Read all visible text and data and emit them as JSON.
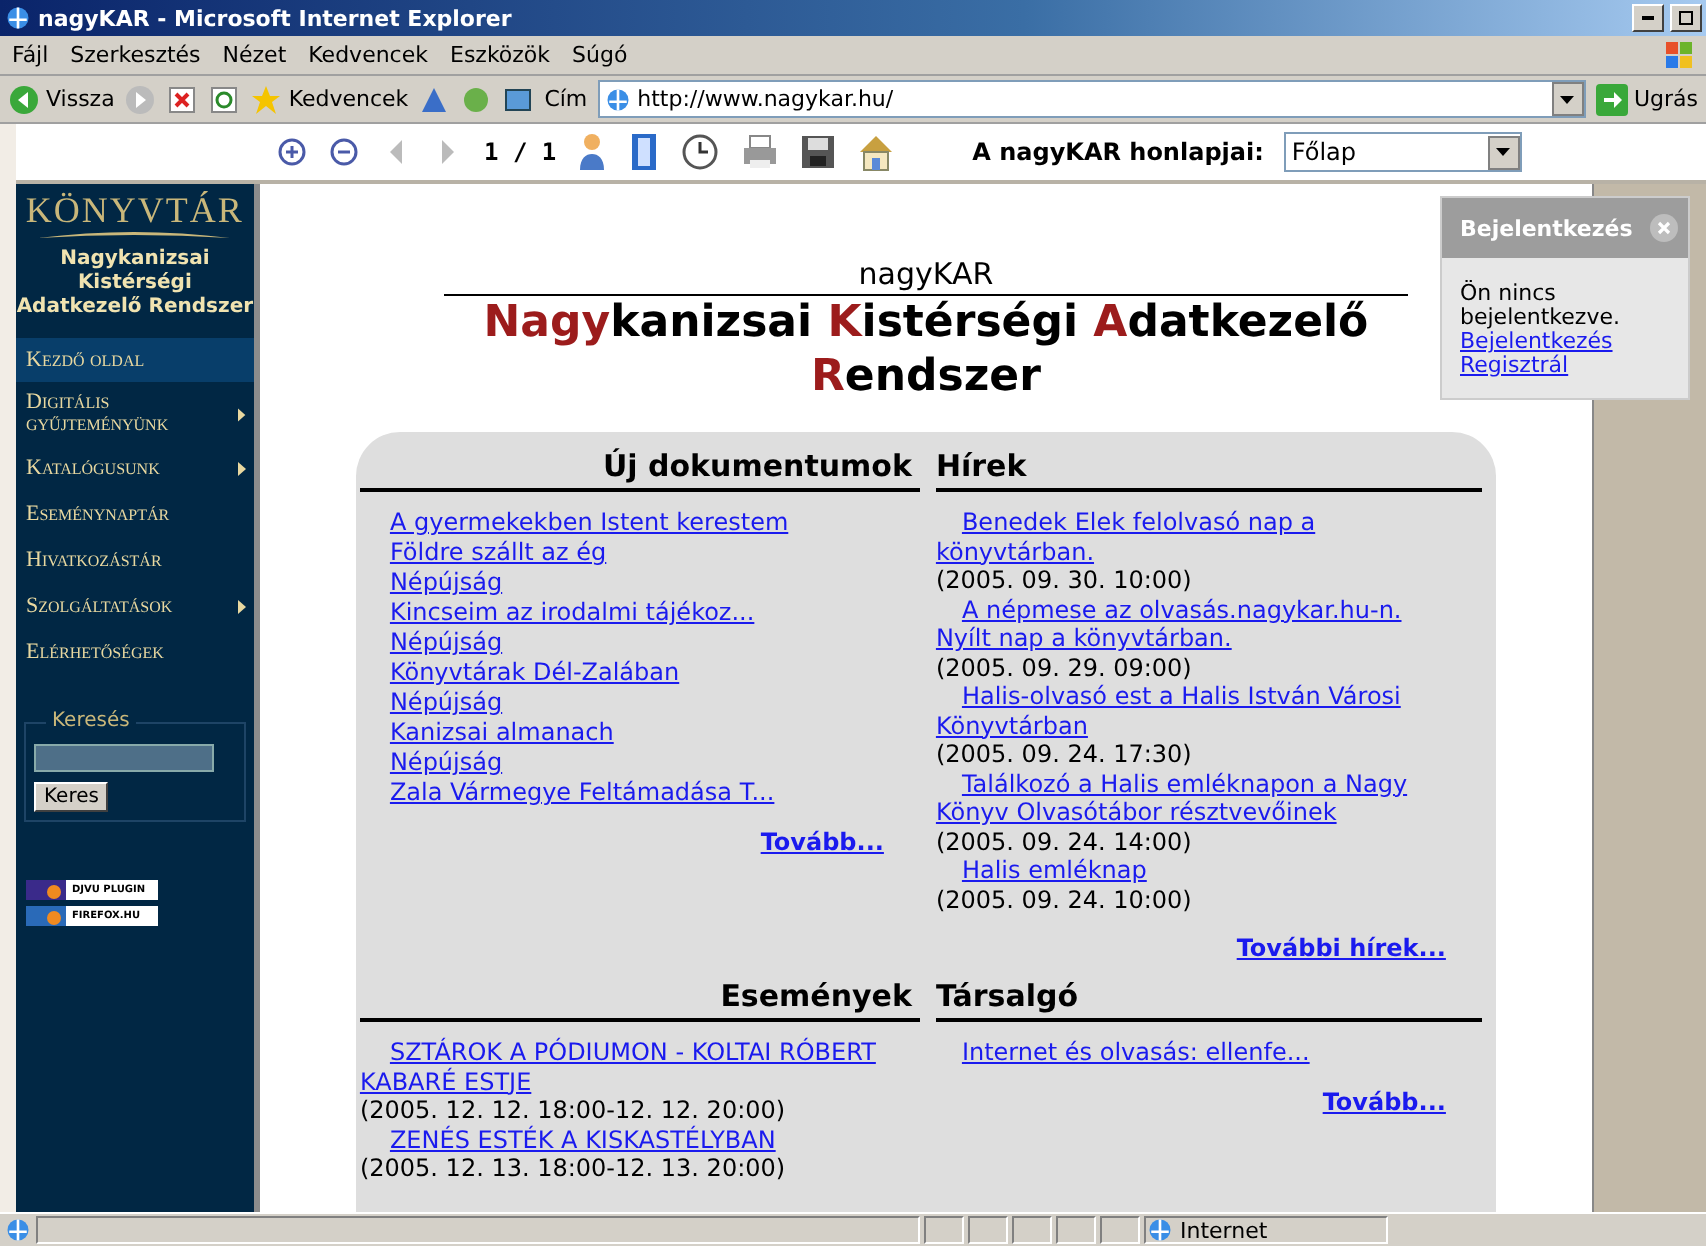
{
  "window": {
    "title": "nagyKAR - Microsoft Internet Explorer"
  },
  "menu": [
    "Fájl",
    "Szerkesztés",
    "Nézet",
    "Kedvencek",
    "Eszközök",
    "Súgó"
  ],
  "toolbar": {
    "back": "Vissza",
    "favorites": "Kedvencek",
    "address_label": "Cím",
    "address": "http://www.nagykar.hu/",
    "go": "Ugrás"
  },
  "viewer_toolbar": {
    "page": "1 / 1",
    "sites_label": "A nagyKAR honlapjai:",
    "sites_value": "Főlap"
  },
  "sidebar": {
    "logo": "KÖNYVTÁR",
    "subtitle_lines": [
      "Nagykanizsai",
      "Kistérségi",
      "Adatkezelő Rendszer"
    ],
    "items": [
      {
        "label": "Kezdő oldal",
        "selected": true,
        "submenu": false
      },
      {
        "label": "Digitális gyűjteményünk",
        "selected": false,
        "submenu": true
      },
      {
        "label": "Katalógusunk",
        "selected": false,
        "submenu": true
      },
      {
        "label": "Eseménynaptár",
        "selected": false,
        "submenu": false
      },
      {
        "label": "Hivatkozástár",
        "selected": false,
        "submenu": false
      },
      {
        "label": "Szolgáltatások",
        "selected": false,
        "submenu": true
      },
      {
        "label": "Elérhetőségek",
        "selected": false,
        "submenu": false
      }
    ],
    "search": {
      "legend": "Keresés",
      "button": "Keres"
    },
    "badges": [
      "DJVU PLUGIN",
      "FIREFOX.HU"
    ]
  },
  "header": {
    "site": "nagyKAR",
    "title": [
      {
        "text": "Nagy",
        "accent": true
      },
      {
        "text": "kanizsai ",
        "accent": false
      },
      {
        "text": "K",
        "accent": true
      },
      {
        "text": "istérségi ",
        "accent": false
      },
      {
        "text": "A",
        "accent": true
      },
      {
        "text": "datkezelő ",
        "accent": false
      },
      {
        "text": "R",
        "accent": true
      },
      {
        "text": "endszer",
        "accent": false
      }
    ]
  },
  "login": {
    "title": "Bejelentkezés",
    "message": "Ön nincs bejelentkezve.",
    "links": [
      "Bejelentkezés",
      "Regisztrál"
    ]
  },
  "documents": {
    "heading": "Új dokumentumok",
    "items": [
      "A gyermekekben Istent kerestem",
      "Földre szállt az ég",
      "Népújság",
      "Kincseim az irodalmi tájékoz...",
      "Népújság",
      "Könyvtárak Dél-Zalában",
      "Népújság",
      "Kanizsai almanach",
      "Népújság",
      "Zala Vármegye Feltámadása T..."
    ],
    "more": "Tovább..."
  },
  "news": {
    "heading": "Hírek",
    "items": [
      {
        "title": "Benedek Elek felolvasó nap a könyvtárban.",
        "date": "(2005. 09. 30. 10:00)"
      },
      {
        "title": "A népmese az olvasás.nagykar.hu-n. Nyílt nap a könyvtárban.",
        "date": "(2005. 09. 29. 09:00)"
      },
      {
        "title": "Halis-olvasó est a Halis István Városi Könyvtárban",
        "date": "(2005. 09. 24. 17:30)"
      },
      {
        "title": "Találkozó a Halis emléknapon a Nagy Könyv Olvasótábor résztvevőinek",
        "date": "(2005. 09. 24. 14:00)"
      },
      {
        "title": "Halis emléknap",
        "date": "(2005. 09. 24. 10:00)"
      }
    ],
    "more": "További hírek..."
  },
  "events": {
    "heading": "Események",
    "items": [
      {
        "title": "SZTÁROK A PÓDIUMON - KOLTAI RÓBERT KABARÉ ESTJE",
        "date": "(2005. 12. 12. 18:00-12. 12. 20:00)"
      },
      {
        "title": "ZENÉS ESTÉK A KISKASTÉLYBAN",
        "date": "(2005. 12. 13. 18:00-12. 13. 20:00)"
      }
    ]
  },
  "forum": {
    "heading": "Társalgó",
    "items": [
      "Internet és olvasás: ellenfe..."
    ],
    "more": "Tovább..."
  },
  "status_bar": {
    "zone": "Internet"
  }
}
